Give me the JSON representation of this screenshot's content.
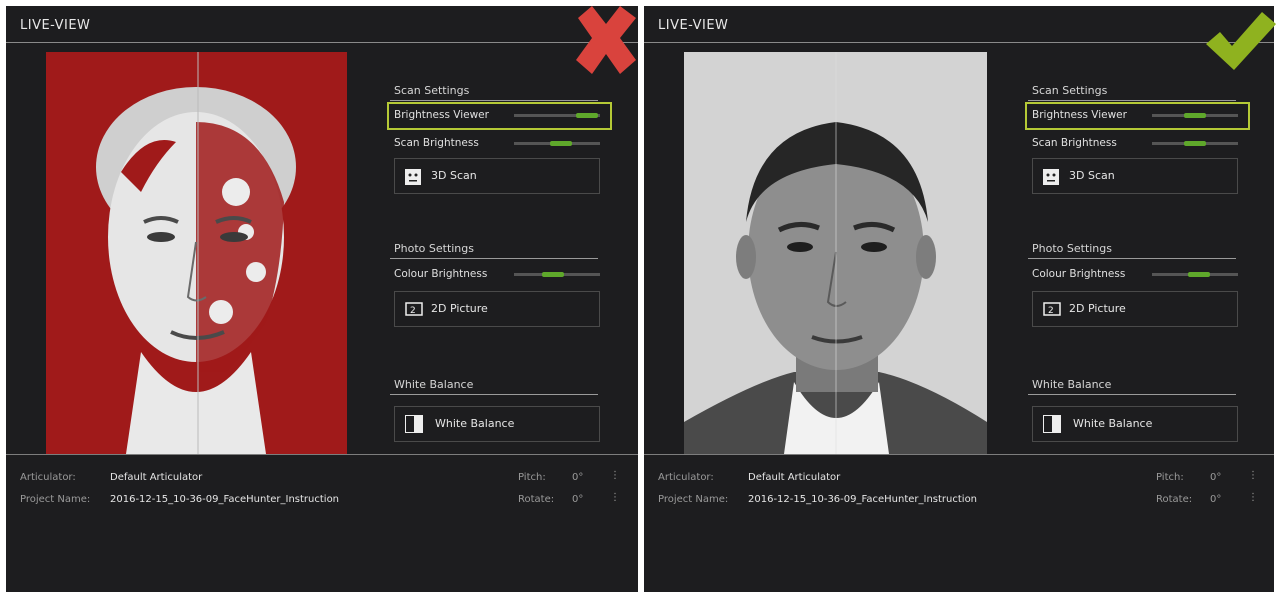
{
  "panels": [
    {
      "title": "LIVE-VIEW",
      "status": "reject",
      "scan_settings": {
        "heading": "Scan Settings",
        "brightness_viewer": "Brightness Viewer",
        "brightness_viewer_level": 0.85,
        "scan_brightness": "Scan Brightness",
        "scan_brightness_level": 0.55,
        "scan_button": "3D Scan"
      },
      "photo_settings": {
        "heading": "Photo Settings",
        "colour_brightness": "Colour Brightness",
        "colour_brightness_level": 0.45,
        "picture_button": "2D Picture"
      },
      "white_balance": {
        "heading": "White Balance",
        "button": "White Balance"
      },
      "footer": {
        "articulator_label": "Articulator:",
        "articulator_value": "Default Articulator",
        "project_label": "Project Name:",
        "project_value": "2016-12-15_10-36-09_FaceHunter_Instruction",
        "pitch_label": "Pitch:",
        "pitch_value": "0°",
        "rotate_label": "Rotate:",
        "rotate_value": "0°"
      }
    },
    {
      "title": "LIVE-VIEW",
      "status": "accept",
      "scan_settings": {
        "heading": "Scan Settings",
        "brightness_viewer": "Brightness Viewer",
        "brightness_viewer_level": 0.5,
        "scan_brightness": "Scan Brightness",
        "scan_brightness_level": 0.5,
        "scan_button": "3D Scan"
      },
      "photo_settings": {
        "heading": "Photo Settings",
        "colour_brightness": "Colour Brightness",
        "colour_brightness_level": 0.55,
        "picture_button": "2D Picture"
      },
      "white_balance": {
        "heading": "White Balance",
        "button": "White Balance"
      },
      "footer": {
        "articulator_label": "Articulator:",
        "articulator_value": "Default Articulator",
        "project_label": "Project Name:",
        "project_value": "2016-12-15_10-36-09_FaceHunter_Instruction",
        "pitch_label": "Pitch:",
        "pitch_value": "0°",
        "rotate_label": "Rotate:",
        "rotate_value": "0°"
      }
    }
  ],
  "colors": {
    "accent": "#5fa82b",
    "highlight": "#b5c936",
    "reject": "#d9433d",
    "accept": "#8fb21f",
    "overexposed": "#a01a1a"
  },
  "icons": {
    "reject": "x-mark-icon",
    "accept": "check-mark-icon",
    "scan": "face-scan-icon",
    "picture": "camera-picture-icon",
    "balance": "white-balance-icon"
  }
}
